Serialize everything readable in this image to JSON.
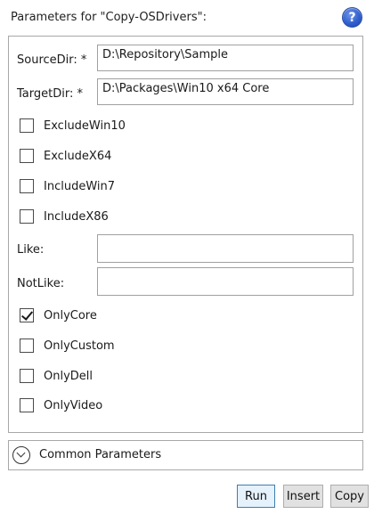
{
  "dialog": {
    "title": "Parameters for \"Copy-OSDrivers\":",
    "help_glyph": "?"
  },
  "params": {
    "source_dir": {
      "label": "SourceDir: *",
      "value": "D:\\Repository\\Sample"
    },
    "target_dir": {
      "label": "TargetDir: *",
      "value": "D:\\Packages\\Win10 x64 Core"
    },
    "exclude_win10": {
      "label": "ExcludeWin10",
      "checked": false
    },
    "exclude_x64": {
      "label": "ExcludeX64",
      "checked": false
    },
    "include_win7": {
      "label": "IncludeWin7",
      "checked": false
    },
    "include_x86": {
      "label": "IncludeX86",
      "checked": false
    },
    "like": {
      "label": "Like:",
      "value": ""
    },
    "notlike": {
      "label": "NotLike:",
      "value": ""
    },
    "only_core": {
      "label": "OnlyCore",
      "checked": true
    },
    "only_custom": {
      "label": "OnlyCustom",
      "checked": false
    },
    "only_dell": {
      "label": "OnlyDell",
      "checked": false
    },
    "only_video": {
      "label": "OnlyVideo",
      "checked": false
    }
  },
  "common_parameters": {
    "label": "Common Parameters"
  },
  "buttons": {
    "run": "Run",
    "insert": "Insert",
    "copy": "Copy"
  },
  "icons": {
    "help": "help-icon",
    "expand": "chevron-down-circle-icon",
    "check": "check-icon"
  }
}
